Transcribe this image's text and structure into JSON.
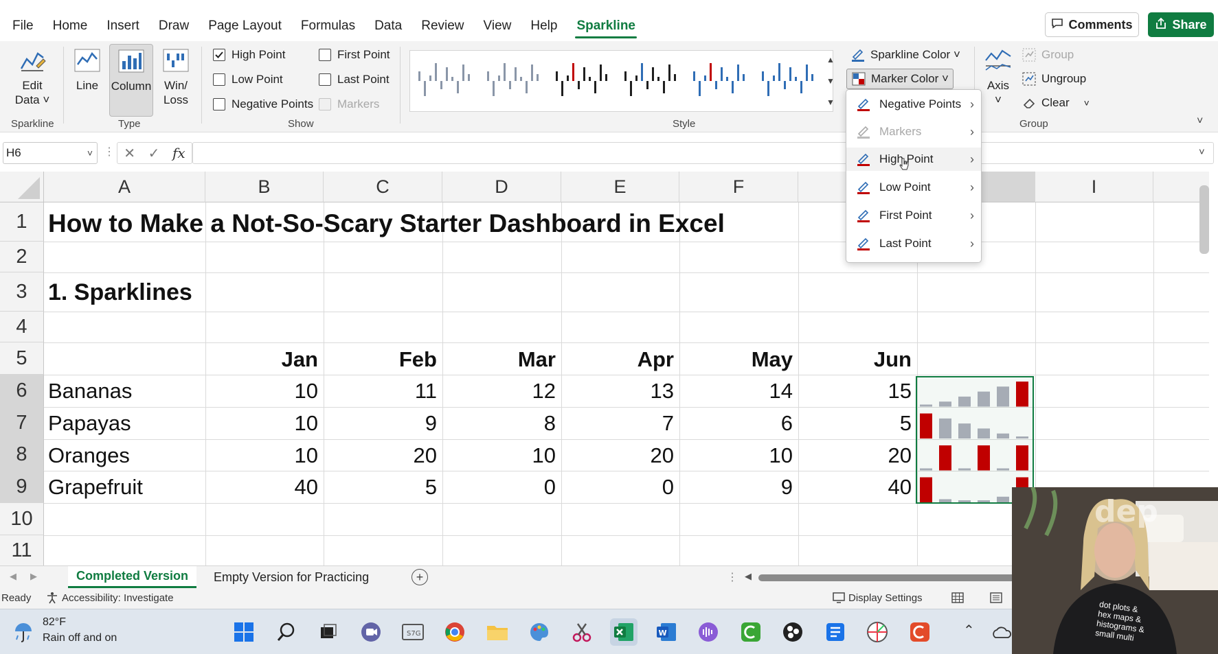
{
  "ribbon_tabs": [
    "File",
    "Home",
    "Insert",
    "Draw",
    "Page Layout",
    "Formulas",
    "Data",
    "Review",
    "View",
    "Help",
    "Sparkline"
  ],
  "active_tab": "Sparkline",
  "header_buttons": {
    "comments": "Comments",
    "share": "Share"
  },
  "groups": {
    "sparkline": {
      "label": "Sparkline",
      "edit_data_line1": "Edit",
      "edit_data_line2": "Data ˅"
    },
    "type": {
      "label": "Type",
      "line": "Line",
      "column": "Column",
      "winloss_line1": "Win/",
      "winloss_line2": "Loss"
    },
    "show": {
      "label": "Show",
      "high_point": "High Point",
      "high_point_checked": true,
      "low_point": "Low Point",
      "low_point_checked": false,
      "negative_points": "Negative Points",
      "negative_points_checked": false,
      "first_point": "First Point",
      "first_point_checked": false,
      "last_point": "Last Point",
      "last_point_checked": false,
      "markers": "Markers",
      "markers_checked": false
    },
    "style": {
      "label": "Style",
      "sparkline_color": "Sparkline Color ˅",
      "marker_color": "Marker Color ˅"
    },
    "group": {
      "label": "Group",
      "axis": "Axis",
      "group": "Group",
      "ungroup": "Ungroup",
      "clear": "Clear"
    }
  },
  "marker_menu": {
    "items": [
      {
        "label": "Negative Points",
        "enabled": true
      },
      {
        "label": "Markers",
        "enabled": false
      },
      {
        "label": "High Point",
        "enabled": true
      },
      {
        "label": "Low Point",
        "enabled": true
      },
      {
        "label": "First Point",
        "enabled": true
      },
      {
        "label": "Last Point",
        "enabled": true
      }
    ]
  },
  "formula_bar": {
    "name_box": "H6",
    "formula": ""
  },
  "sheet": {
    "columns": [
      "A",
      "B",
      "C",
      "D",
      "E",
      "F",
      "",
      "I"
    ],
    "rows": [
      "1",
      "2",
      "3",
      "4",
      "5",
      "6",
      "7",
      "8",
      "9",
      "10",
      "11"
    ],
    "title": "How to Make a Not-So-Scary Starter Dashboard in Excel",
    "section": "1. Sparklines",
    "months": [
      "Jan",
      "Feb",
      "Mar",
      "Apr",
      "May",
      "Jun"
    ],
    "data": [
      {
        "fruit": "Bananas",
        "values": [
          "10",
          "11",
          "12",
          "13",
          "14",
          "15"
        ]
      },
      {
        "fruit": "Papayas",
        "values": [
          "10",
          "9",
          "8",
          "7",
          "6",
          "5"
        ]
      },
      {
        "fruit": "Oranges",
        "values": [
          "10",
          "20",
          "10",
          "20",
          "10",
          "20"
        ]
      },
      {
        "fruit": "Grapefruit",
        "values": [
          "40",
          "5",
          "0",
          "0",
          "9",
          "40"
        ]
      }
    ],
    "high_point_color": "#c00000",
    "column_color": "#a6acb5"
  },
  "sheet_tabs": [
    "Completed Version",
    "Empty Version for Practicing"
  ],
  "status": {
    "ready": "Ready",
    "accessibility": "Accessibility: Investigate",
    "display_settings": "Display Settings"
  },
  "weather": {
    "temp": "82°F",
    "desc": "Rain off and on"
  },
  "webcam_shirt_text": [
    "dot plots &",
    "hex maps &",
    "histograms &",
    "small multi"
  ]
}
